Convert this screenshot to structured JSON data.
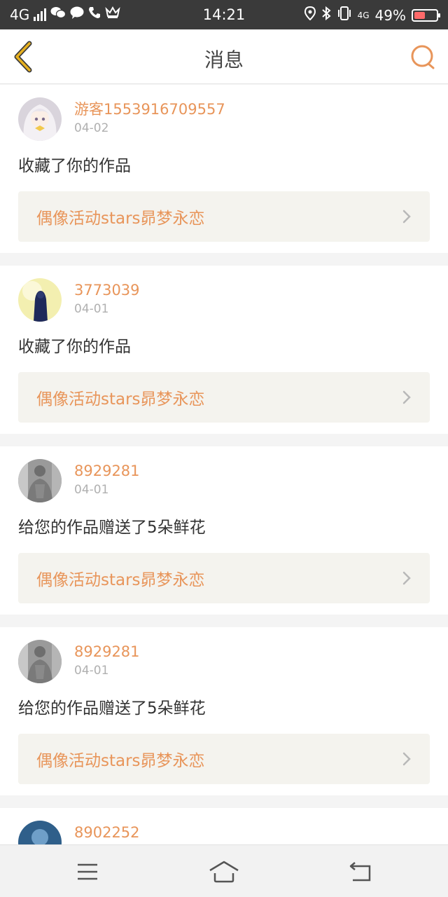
{
  "status_bar": {
    "network": "4G",
    "time": "14:21",
    "network2": "4G",
    "battery": "49%",
    "battery_level": 0.49,
    "icons": [
      "signal-icon",
      "wechat-icon",
      "message-icon",
      "phone-icon",
      "crown-icon",
      "location-icon",
      "bluetooth-icon",
      "vibrate-icon",
      "battery-icon"
    ]
  },
  "header": {
    "title": "消息",
    "back_icon": "chevron-left-icon",
    "search_icon": "search-icon"
  },
  "messages": [
    {
      "username": "游客1553916709557",
      "date": "04-02",
      "text": "收藏了你的作品",
      "work": "偶像活动stars昴梦永恋",
      "avatar": "anime-girl-avatar"
    },
    {
      "username": "3773039",
      "date": "04-01",
      "text": "收藏了你的作品",
      "work": "偶像活动stars昴梦永恋",
      "avatar": "hooded-figure-avatar"
    },
    {
      "username": "8929281",
      "date": "04-01",
      "text": "给您的作品赠送了5朵鲜花",
      "work": "偶像活动stars昴梦永恋",
      "avatar": "man-photo-avatar"
    },
    {
      "username": "8929281",
      "date": "04-01",
      "text": "给您的作品赠送了5朵鲜花",
      "work": "偶像活动stars昴梦永恋",
      "avatar": "man-photo-avatar"
    },
    {
      "username": "8902252",
      "date": "",
      "text": "",
      "work": "",
      "avatar": "blue-avatar"
    }
  ],
  "nav_bar": {
    "items": [
      "menu-icon",
      "home-icon",
      "back-icon"
    ]
  },
  "colors": {
    "accent": "#e8955a",
    "back_arrow": "#e6b020",
    "status_bar_bg": "#3a3a3a"
  }
}
